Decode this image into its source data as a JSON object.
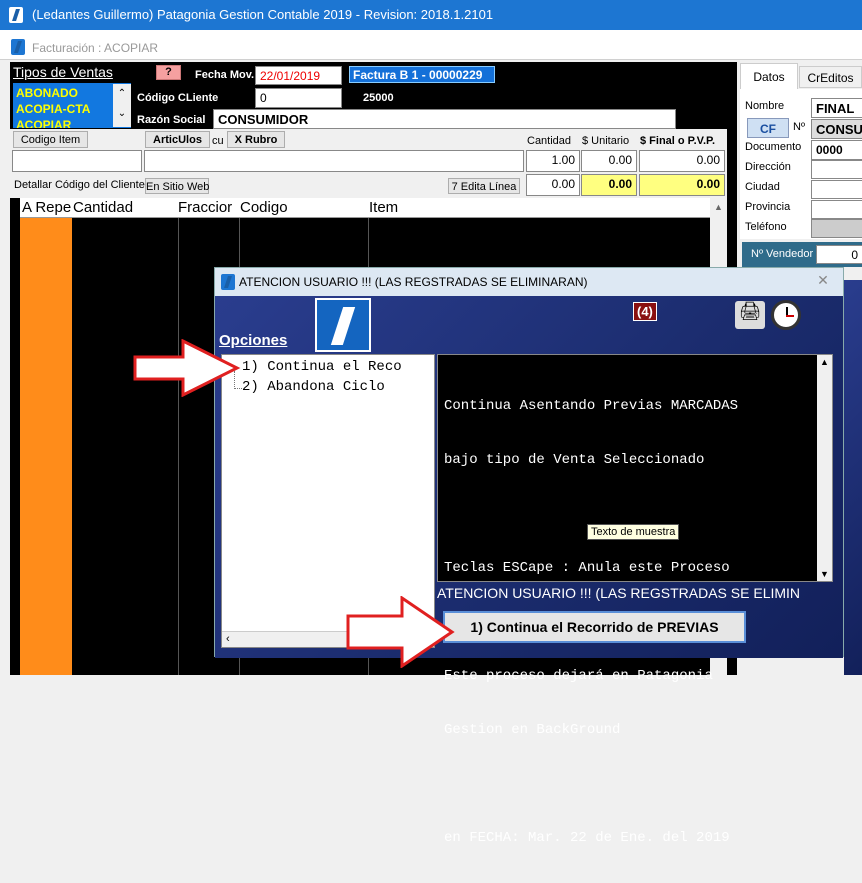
{
  "window": {
    "title": "(Ledantes Guillermo) Patagonia Gestion Contable 2019 - Revision: 2018.1.2101"
  },
  "subwindow": {
    "title": "Facturación : ACOPIAR"
  },
  "header": {
    "tipos_label": "Tipos de Ventas",
    "tipos_items": [
      "ABONADO",
      "ACOPIA-CTA",
      "ACOPIAR"
    ],
    "question_btn": "?",
    "fecha_label": "Fecha Mov.",
    "fecha_value": "22/01/2019",
    "factura": "Factura  B    1 - 00000229",
    "codigo_cliente_label": "Código CLiente",
    "codigo_cliente_value": "0",
    "num_25000": "25000",
    "razon_label": "Razón Social",
    "razon_value": "CONSUMIDOR"
  },
  "items_bar": {
    "codigo_item_btn": "Codigo Item",
    "articulos_btn": "ArticUlos",
    "cu_label": "cu",
    "rubro_btn": "X Rubro",
    "cantidad_label": "Cantidad",
    "unitario_label": "$ Unitario",
    "final_label": "$ Final o P.V.P.",
    "cantidad_value": "1.00",
    "unitario_value": "0.00",
    "final_value": "0.00",
    "detallar_label": "Detallar Código del Cliente",
    "en_sitio_btn": "En Sitio Web",
    "edita_btn": "7 Edita Línea",
    "row2_cantidad": "0.00",
    "row2_unitario": "0.00",
    "row2_final": "0.00"
  },
  "grid": {
    "headers": [
      "A Repe",
      "Cantidad",
      "Fraccior",
      "Codigo",
      "Item"
    ]
  },
  "right_panel": {
    "tabs": [
      "Datos",
      "CrEditos"
    ],
    "nombre_label": "Nombre",
    "nombre_value": "FINAL",
    "cf": "CF",
    "no_label": "Nº",
    "consu_value": "CONSU",
    "documento_label": "Documento",
    "documento_value": "0000",
    "direccion_label": "Dirección",
    "ciudad_label": "Ciudad",
    "provincia_label": "Provincia",
    "telefono_label": "Teléfono",
    "vendedor_label": "Nº Vendedor",
    "vendedor_value": "0"
  },
  "dialog": {
    "title": "ATENCION USUARIO !!! (LAS REGSTRADAS SE ELIMINARAN)",
    "badge": "(4)",
    "opciones_label": "Opciones",
    "options": [
      "1) Continua el Reco",
      "2) Abandona Ciclo"
    ],
    "message_lines": [
      "Continua Asentando Previas MARCADAS",
      "bajo tipo de Venta Seleccionado",
      "",
      "Teclas ESCape : Anula este Proceso",
      "",
      "Este proceso dejará en Patagonia",
      "Gestion en BackGround",
      "",
      "en FECHA: Mar. 22 de Ene. del 2019"
    ],
    "tooltip": "Texto de muestra",
    "footer_text": "ATENCION USUARIO !!! (LAS REGSTRADAS SE ELIMIN",
    "action_button": "1) Continua el Recorrido de PREVIAS"
  },
  "colors": {
    "titlebar": "#1d76d2",
    "orange": "#ff8c1a",
    "yellow": "#ffff80",
    "dialog_bg": "#1b2c6e"
  }
}
